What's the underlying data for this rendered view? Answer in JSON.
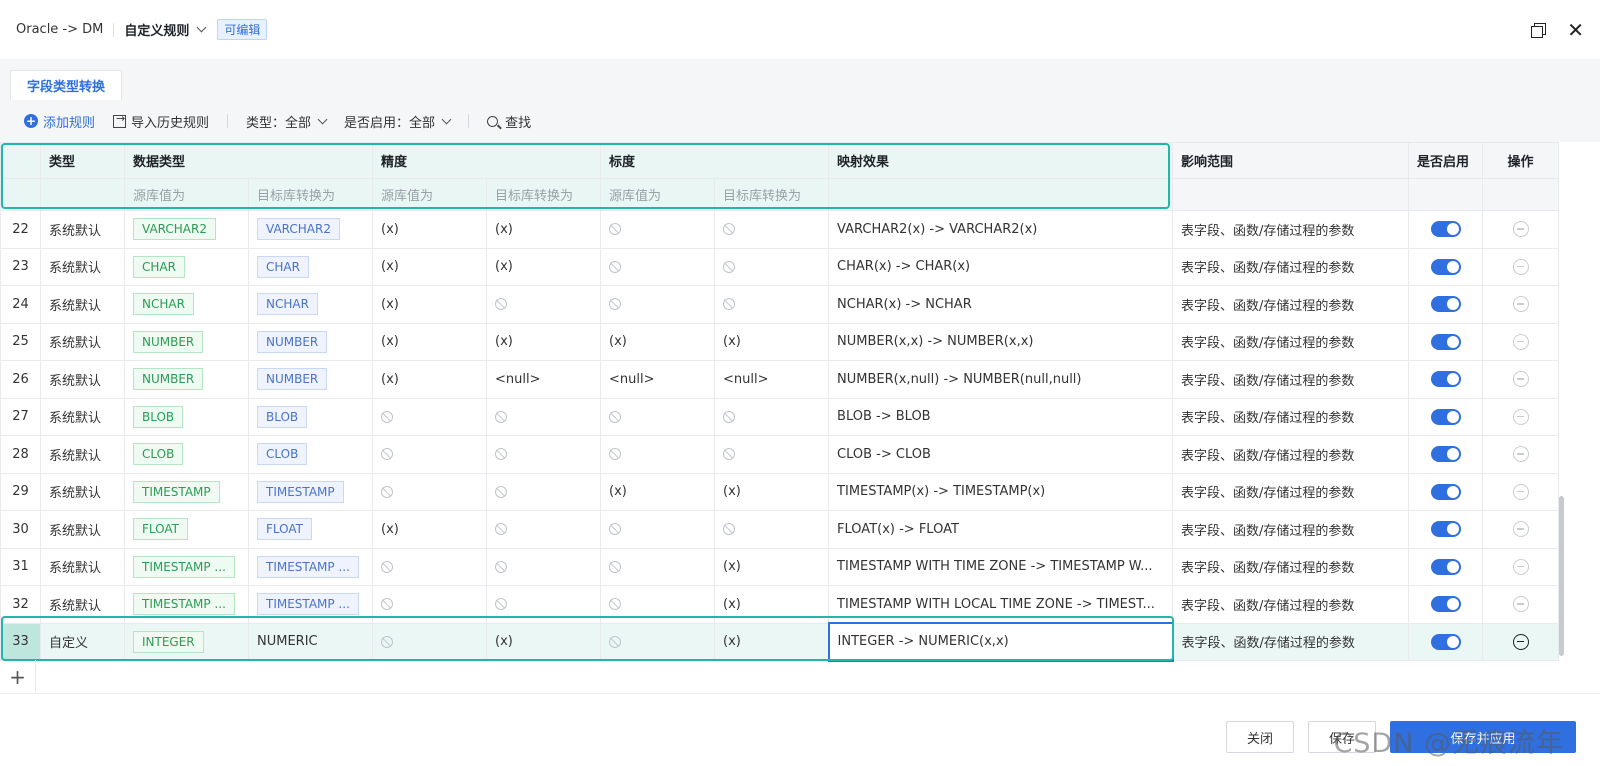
{
  "header": {
    "path": "Oracle -> DM",
    "rule_selector": "自定义规则",
    "badge": "可编辑"
  },
  "tabs": [
    {
      "label": "字段类型转换",
      "active": true
    }
  ],
  "toolbar": {
    "add_rule": "添加规则",
    "import_history": "导入历史规则",
    "type_filter": "类型：全部",
    "enabled_filter": "是否启用：全部",
    "search": "查找"
  },
  "table": {
    "headers": {
      "type": "类型",
      "data_type": "数据类型",
      "precision": "精度",
      "scale": "标度",
      "mapping": "映射效果",
      "scope": "影响范围",
      "enabled": "是否启用",
      "action": "操作"
    },
    "subheaders": {
      "source": "源库值为",
      "target": "目标库转换为"
    },
    "rows": [
      {
        "num": "22",
        "type": "系统默认",
        "src_type": "VARCHAR2",
        "dst_type": "VARCHAR2",
        "p_src": "(x)",
        "p_dst": "(x)",
        "s_src": "",
        "s_dst": "",
        "mapping": "VARCHAR2(x) -> VARCHAR2(x)",
        "scope": "表字段、函数/存储过程的参数"
      },
      {
        "num": "23",
        "type": "系统默认",
        "src_type": "CHAR",
        "dst_type": "CHAR",
        "p_src": "(x)",
        "p_dst": "(x)",
        "s_src": "",
        "s_dst": "",
        "mapping": "CHAR(x) -> CHAR(x)",
        "scope": "表字段、函数/存储过程的参数"
      },
      {
        "num": "24",
        "type": "系统默认",
        "src_type": "NCHAR",
        "dst_type": "NCHAR",
        "p_src": "(x)",
        "p_dst": "",
        "s_src": "",
        "s_dst": "",
        "mapping": "NCHAR(x) -> NCHAR",
        "scope": "表字段、函数/存储过程的参数"
      },
      {
        "num": "25",
        "type": "系统默认",
        "src_type": "NUMBER",
        "dst_type": "NUMBER",
        "p_src": "(x)",
        "p_dst": "(x)",
        "s_src": "(x)",
        "s_dst": "(x)",
        "mapping": "NUMBER(x,x) -> NUMBER(x,x)",
        "scope": "表字段、函数/存储过程的参数"
      },
      {
        "num": "26",
        "type": "系统默认",
        "src_type": "NUMBER",
        "dst_type": "NUMBER",
        "p_src": "(x)",
        "p_dst": "<null>",
        "s_src": "<null>",
        "s_dst": "<null>",
        "mapping": "NUMBER(x,null) -> NUMBER(null,null)",
        "scope": "表字段、函数/存储过程的参数"
      },
      {
        "num": "27",
        "type": "系统默认",
        "src_type": "BLOB",
        "dst_type": "BLOB",
        "p_src": "",
        "p_dst": "",
        "s_src": "",
        "s_dst": "",
        "mapping": "BLOB -> BLOB",
        "scope": "表字段、函数/存储过程的参数"
      },
      {
        "num": "28",
        "type": "系统默认",
        "src_type": "CLOB",
        "dst_type": "CLOB",
        "p_src": "",
        "p_dst": "",
        "s_src": "",
        "s_dst": "",
        "mapping": "CLOB -> CLOB",
        "scope": "表字段、函数/存储过程的参数"
      },
      {
        "num": "29",
        "type": "系统默认",
        "src_type": "TIMESTAMP",
        "dst_type": "TIMESTAMP",
        "p_src": "",
        "p_dst": "",
        "s_src": "(x)",
        "s_dst": "(x)",
        "mapping": "TIMESTAMP(x) -> TIMESTAMP(x)",
        "scope": "表字段、函数/存储过程的参数"
      },
      {
        "num": "30",
        "type": "系统默认",
        "src_type": "FLOAT",
        "dst_type": "FLOAT",
        "p_src": "(x)",
        "p_dst": "",
        "s_src": "",
        "s_dst": "",
        "mapping": "FLOAT(x) -> FLOAT",
        "scope": "表字段、函数/存储过程的参数"
      },
      {
        "num": "31",
        "type": "系统默认",
        "src_type": "TIMESTAMP ...",
        "dst_type": "TIMESTAMP ...",
        "p_src": "",
        "p_dst": "",
        "s_src": "",
        "s_dst": "(x)",
        "mapping": "TIMESTAMP WITH TIME ZONE -> TIMESTAMP W...",
        "scope": "表字段、函数/存储过程的参数"
      },
      {
        "num": "32",
        "type": "系统默认",
        "src_type": "TIMESTAMP ...",
        "dst_type": "TIMESTAMP ...",
        "p_src": "",
        "p_dst": "",
        "s_src": "",
        "s_dst": "(x)",
        "mapping": "TIMESTAMP WITH LOCAL TIME ZONE -> TIMEST...",
        "scope": "表字段、函数/存储过程的参数"
      },
      {
        "num": "33",
        "type": "自定义",
        "src_type": "INTEGER",
        "dst_type": "NUMERIC",
        "p_src": "",
        "p_dst": "(x)",
        "s_src": "",
        "s_dst": "(x)",
        "mapping": "INTEGER -> NUMERIC(x,x)",
        "scope": "表字段、函数/存储过程的参数"
      }
    ]
  },
  "footer": {
    "close": "关闭",
    "save": "保存",
    "primary": "保存并应用"
  },
  "watermark": "CSDN @无痕流年",
  "colors": {
    "accent": "#2f6fe0",
    "highlight": "#22b5a8",
    "src_tag": "#2d9b55",
    "dst_tag": "#4a73c9"
  }
}
